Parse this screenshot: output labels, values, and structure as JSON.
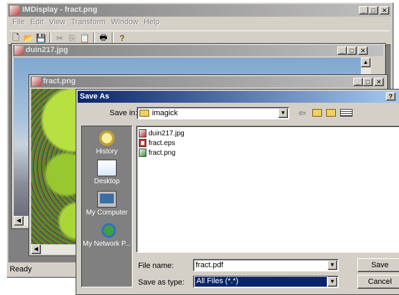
{
  "main_window": {
    "title": "IMDisplay - fract.png",
    "menu": [
      "File",
      "Edit",
      "View",
      "Transform",
      "Window",
      "Help"
    ],
    "toolbar_icons": [
      "new-icon",
      "open-icon",
      "save-icon",
      "cut-icon",
      "copy-icon",
      "paste-icon",
      "print-icon",
      "help-icon"
    ],
    "status": "Ready"
  },
  "child_window_1": {
    "title": "duin217.jpg"
  },
  "child_window_2": {
    "title": "fract.png"
  },
  "dialog": {
    "title": "Save As",
    "help_glyph": "?",
    "save_in_label": "Save in:",
    "save_in_value": "imagick",
    "places": [
      {
        "label": "History",
        "icon": "history-icon"
      },
      {
        "label": "Desktop",
        "icon": "desktop-icon"
      },
      {
        "label": "My Computer",
        "icon": "my-computer-icon"
      },
      {
        "label": "My Network P...",
        "icon": "network-places-icon"
      }
    ],
    "files": [
      {
        "name": "duin217.jpg",
        "icon": "image-file-icon"
      },
      {
        "name": "fract.eps",
        "icon": "eps-file-icon"
      },
      {
        "name": "fract.png",
        "icon": "image-file-icon"
      }
    ],
    "file_name_label": "File name:",
    "file_name_value": "fract.pdf",
    "save_as_type_label": "Save as type:",
    "save_as_type_value": "All Files (*.*)",
    "save_button": "Save",
    "cancel_button": "Cancel"
  },
  "colors": {
    "title_active": "#0a246a",
    "face": "#d4d0c8",
    "places_bar": "#808080",
    "selection": "#0a246a"
  }
}
